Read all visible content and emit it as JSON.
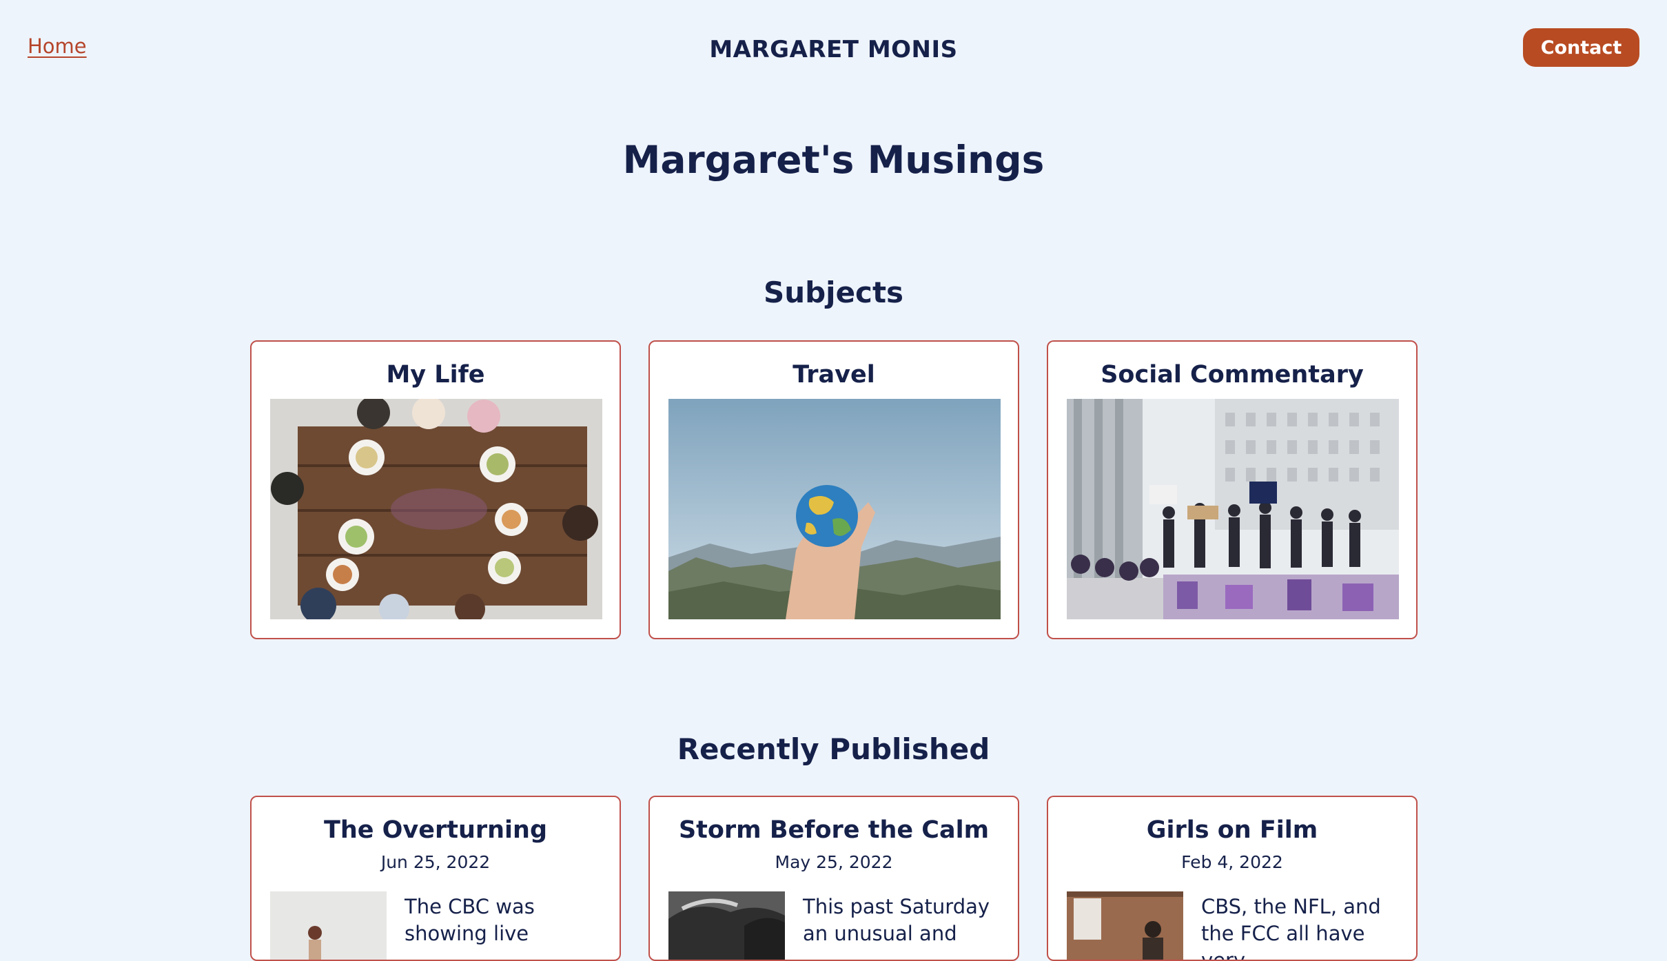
{
  "header": {
    "home_link": "Home",
    "site_name": "MARGARET MONIS",
    "contact_button": "Contact"
  },
  "page": {
    "title": "Margaret's Musings"
  },
  "subjects": {
    "heading": "Subjects",
    "items": [
      {
        "title": "My Life"
      },
      {
        "title": "Travel"
      },
      {
        "title": "Social Commentary"
      }
    ]
  },
  "recent": {
    "heading": "Recently Published",
    "posts": [
      {
        "title": "The Overturning",
        "date": "Jun 25, 2022",
        "excerpt": "The CBC was showing live"
      },
      {
        "title": "Storm Before the Calm",
        "date": "May 25, 2022",
        "excerpt": "This past Saturday an unusual and"
      },
      {
        "title": "Girls on Film",
        "date": "Feb 4, 2022",
        "excerpt": "CBS, the NFL, and the FCC all have very"
      }
    ]
  },
  "colors": {
    "background": "#eef4fc",
    "text": "#16214a",
    "accent": "#b84b22",
    "card_border": "#c0504a"
  }
}
